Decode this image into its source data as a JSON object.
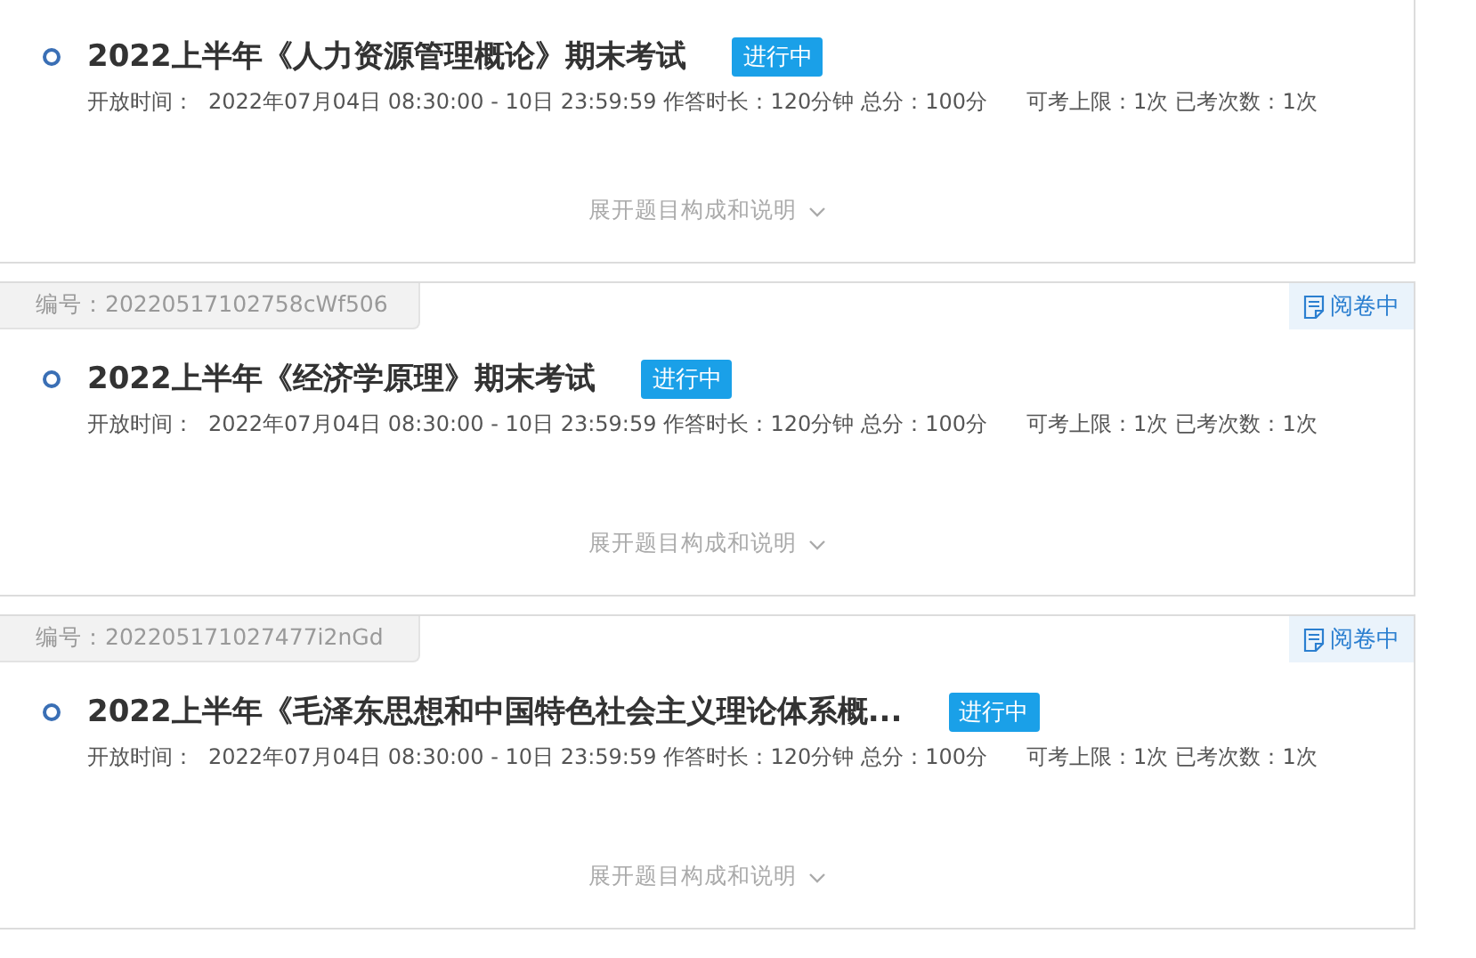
{
  "exams": [
    {
      "title": "2022上半年《人力资源管理概论》期末考试",
      "badge": "进行中",
      "meta": [
        "开放时间：",
        "2022年07月04日 08:30:00 - 10日 23:59:59",
        "作答时长：120分钟",
        "总分：100分",
        "可考上限：1次",
        "已考次数：1次"
      ],
      "expand": "展开题目构成和说明"
    },
    {
      "code": "编号：20220517102758cWf506",
      "status": "阅卷中",
      "title": "2022上半年《经济学原理》期末考试",
      "badge": "进行中",
      "meta": [
        "开放时间：",
        "2022年07月04日 08:30:00 - 10日 23:59:59",
        "作答时长：120分钟",
        "总分：100分",
        "可考上限：1次",
        "已考次数：1次"
      ],
      "expand": "展开题目构成和说明"
    },
    {
      "code": "编号：202205171027477i2nGd",
      "status": "阅卷中",
      "title": "2022上半年《毛泽东思想和中国特色社会主义理论体系概...",
      "badge": "进行中",
      "meta": [
        "开放时间：",
        "2022年07月04日 08:30:00 - 10日 23:59:59",
        "作答时长：120分钟",
        "总分：100分",
        "可考上限：1次",
        "已考次数：1次"
      ],
      "expand": "展开题目构成和说明"
    }
  ]
}
